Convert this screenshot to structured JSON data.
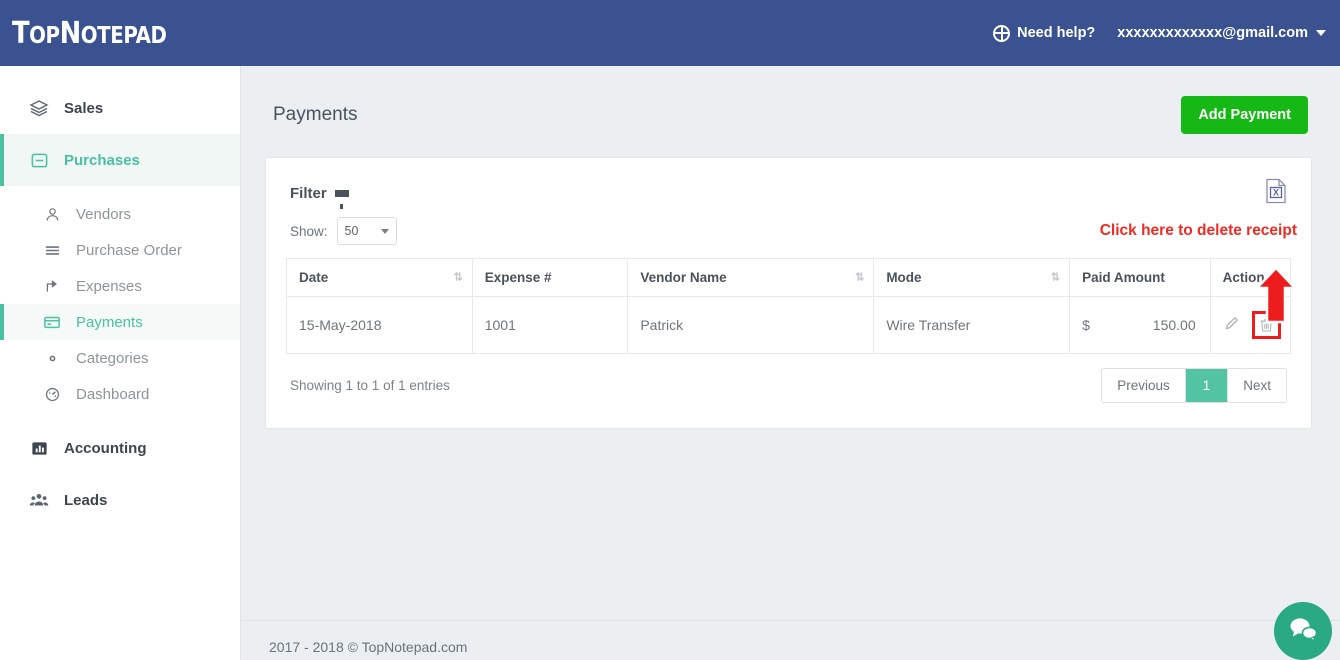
{
  "topbar": {
    "logo_top": "T",
    "logo_op": "OP",
    "logo_n": "N",
    "logo_otepad": "OTEPAD",
    "logo_full": "TopNotepad",
    "help_label": "Need help?",
    "account_email": "xxxxxxxxxxxxx@gmail.com",
    "brand_color": "#3b5291"
  },
  "sidebar": {
    "items": [
      {
        "label": "Sales",
        "icon": "layers-icon",
        "level": "top",
        "active": false
      },
      {
        "label": "Purchases",
        "icon": "minus-box-icon",
        "level": "top",
        "active": true
      },
      {
        "label": "Vendors",
        "icon": "user-outline-icon",
        "level": "sub",
        "active": false
      },
      {
        "label": "Purchase Order",
        "icon": "list-icon",
        "level": "sub",
        "active": false
      },
      {
        "label": "Expenses",
        "icon": "share-icon",
        "level": "sub",
        "active": false
      },
      {
        "label": "Payments",
        "icon": "credit-card-icon",
        "level": "sub",
        "active": true
      },
      {
        "label": "Categories",
        "icon": "gear-icon",
        "level": "sub",
        "active": false
      },
      {
        "label": "Dashboard",
        "icon": "gauge-icon",
        "level": "sub",
        "active": false
      },
      {
        "label": "Accounting",
        "icon": "bar-chart-icon",
        "level": "top",
        "active": false
      },
      {
        "label": "Leads",
        "icon": "people-icon",
        "level": "top",
        "active": false
      }
    ],
    "active_color": "#4ac1a0"
  },
  "page": {
    "title": "Payments",
    "add_button": "Add Payment",
    "add_button_color": "#16b816"
  },
  "card": {
    "filter_label": "Filter",
    "export_icon": "excel-export-icon",
    "show_label": "Show:",
    "show_value": "50",
    "show_options": [
      "50"
    ],
    "annotation": "Click here to delete receipt",
    "annotation_color": "#ee2b24"
  },
  "table": {
    "columns": [
      {
        "label": "Date",
        "sortable": true
      },
      {
        "label": "Expense #",
        "sortable": false
      },
      {
        "label": "Vendor Name",
        "sortable": true
      },
      {
        "label": "Mode",
        "sortable": true
      },
      {
        "label": "Paid Amount",
        "sortable": false
      },
      {
        "label": "Action",
        "sortable": false
      }
    ],
    "rows": [
      {
        "date": "15-May-2018",
        "expense_no": "1001",
        "vendor_name": "Patrick",
        "mode": "Wire Transfer",
        "currency": "$",
        "amount": "150.00"
      }
    ],
    "sort_glyph": "⇅"
  },
  "pagination": {
    "entries_text": "Showing 1 to 1 of 1 entries",
    "previous": "Previous",
    "current_page": "1",
    "next": "Next",
    "active_color": "#52c3a3"
  },
  "footer": {
    "copyright": "2017 - 2018 © TopNotepad.com"
  },
  "chat": {
    "icon": "chat-bubbles-icon",
    "color": "#29a984"
  }
}
